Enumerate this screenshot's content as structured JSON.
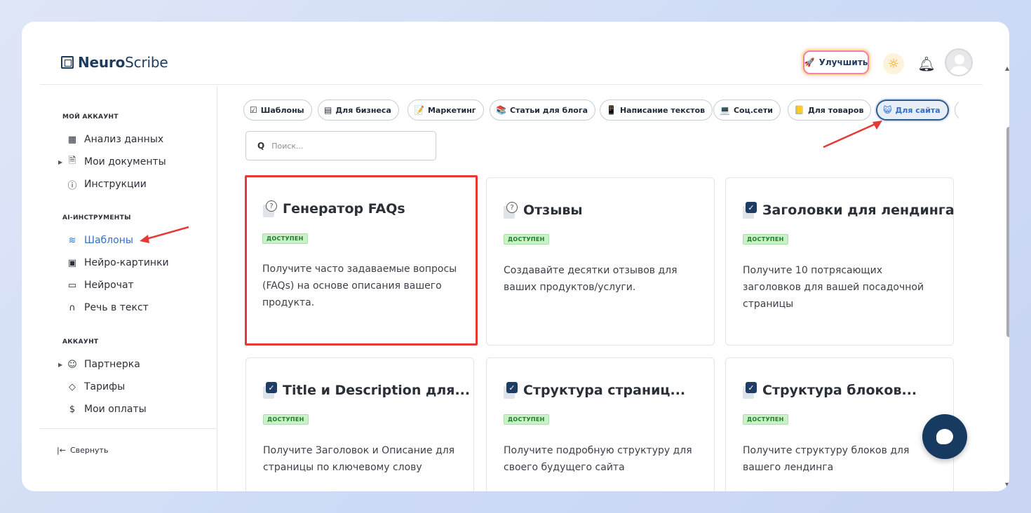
{
  "brand": {
    "name_bold": "Neuro",
    "name_regular": "Scribe"
  },
  "header": {
    "upgrade_label": "Улучшить"
  },
  "sidebar": {
    "section_account": "МОЙ АККАУНТ",
    "account_items": [
      "Анализ данных",
      "Мои документы",
      "Инструкции"
    ],
    "section_ai": "AI-ИНСТРУМЕНТЫ",
    "ai_items": [
      "Шаблоны",
      "Нейро-картинки",
      "Нейрочат",
      "Речь в текст"
    ],
    "section_acc2": "АККАУНТ",
    "acc2_items": [
      "Партнерка",
      "Тарифы",
      "Мои оплаты"
    ],
    "collapse_label": "Свернуть"
  },
  "chips": [
    "Шаблоны",
    "Для бизнеса",
    "Маркетинг",
    "Статьи для блога",
    "Написание текстов",
    "Соц.сети",
    "Для товаров",
    "Для сайта"
  ],
  "search": {
    "placeholder": "Поиск..."
  },
  "badge_label": "ДОСТУПЕН",
  "cards": [
    {
      "title": "Генератор FAQs",
      "desc": "Получите часто задаваемые вопросы (FAQs) на основе описания вашего продукта."
    },
    {
      "title": "Отзывы",
      "desc": "Создавайте десятки отзывов для ваших продуктов/услуги."
    },
    {
      "title": "Заголовки для лендинга",
      "desc": "Получите 10 потрясающих заголовков для вашей посадочной страницы"
    },
    {
      "title": "Title и Description для...",
      "desc": "Получите Заголовок и Описание для страницы по ключевому слову"
    },
    {
      "title": "Структура страниц...",
      "desc": "Получите подробную структуру для своего будущего сайта"
    },
    {
      "title": "Структура блоков...",
      "desc": "Получите структуру блоков для вашего лендинга"
    }
  ],
  "colors": {
    "accent": "#2f6fc8",
    "highlight": "#e53935",
    "badge_bg": "#c9f2c9",
    "chat_button": "#173a60"
  }
}
